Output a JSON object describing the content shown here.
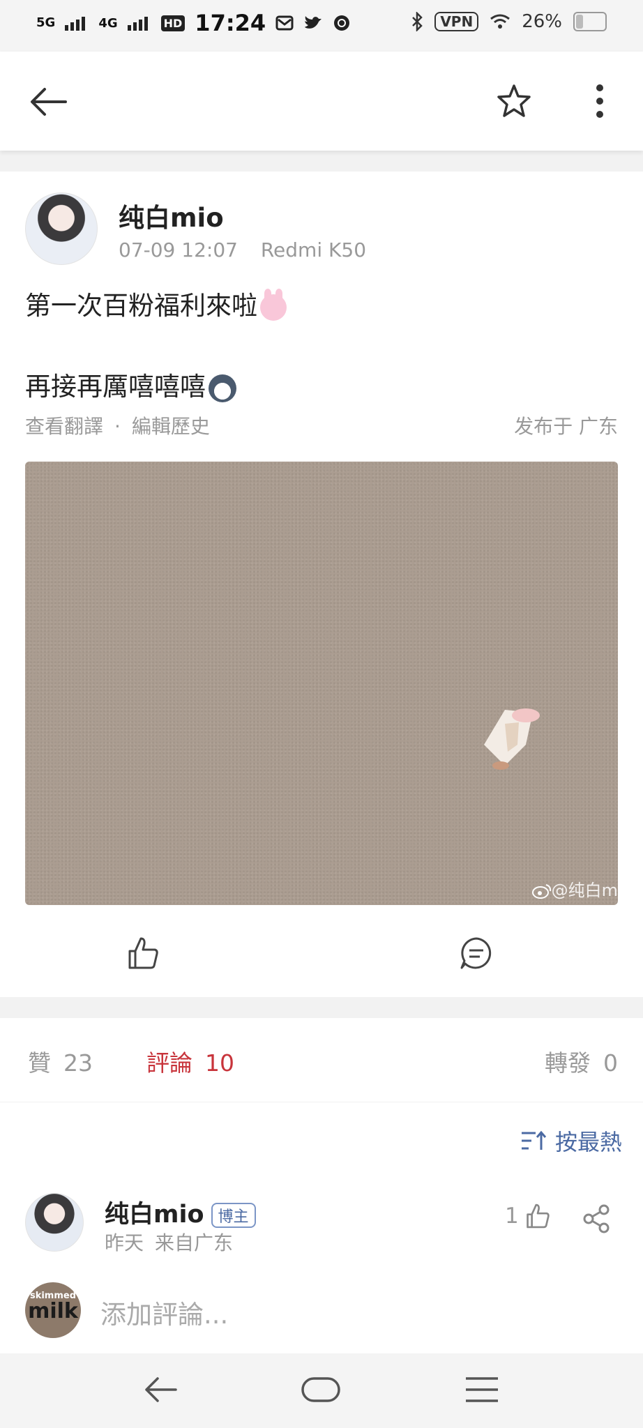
{
  "status_bar": {
    "signal_label_1": "5G",
    "signal_label_2": "4G",
    "hd_label": "HD",
    "time": "17:24",
    "vpn_label": "VPN",
    "battery_percent": "26%",
    "battery_level": 0.26,
    "icons": [
      "mail-icon",
      "twitter-icon",
      "app-icon",
      "bluetooth-icon",
      "wifi-icon",
      "battery-icon"
    ]
  },
  "app_bar": {
    "icons": [
      "back-arrow-icon",
      "star-icon",
      "more-vertical-icon"
    ]
  },
  "post": {
    "author": "纯白mio",
    "time": "07-09 12:07",
    "device": "Redmi K50",
    "line1": "第一次百粉福利來啦",
    "line2": "再接再厲嘻嘻嘻",
    "translate_link": "查看翻譯",
    "separator": "·",
    "history_link": "編輯歷史",
    "location": "发布于 广东",
    "image_watermark": "@纯白m",
    "colors": {
      "photo_bg": "#ab9d91"
    }
  },
  "stats": {
    "likes_label": "贊",
    "likes_count": "23",
    "comments_label": "評論",
    "comments_count": "10",
    "reposts_label": "轉發",
    "reposts_count": "0",
    "colors": {
      "active": "#c8343b"
    }
  },
  "sort": {
    "label": "按最熱",
    "icon": "sort-icon",
    "color": "#4b6aa3"
  },
  "comment": {
    "author": "纯白mio",
    "badge": "博主",
    "time": "昨天",
    "location": "来自广东",
    "likes": "1"
  },
  "input": {
    "avatar_text_small": "skimmed",
    "avatar_text_big": "milk",
    "placeholder": "添加評論..."
  },
  "nav_bar": {
    "icons": [
      "nav-back-icon",
      "nav-home-icon",
      "nav-menu-icon"
    ]
  }
}
